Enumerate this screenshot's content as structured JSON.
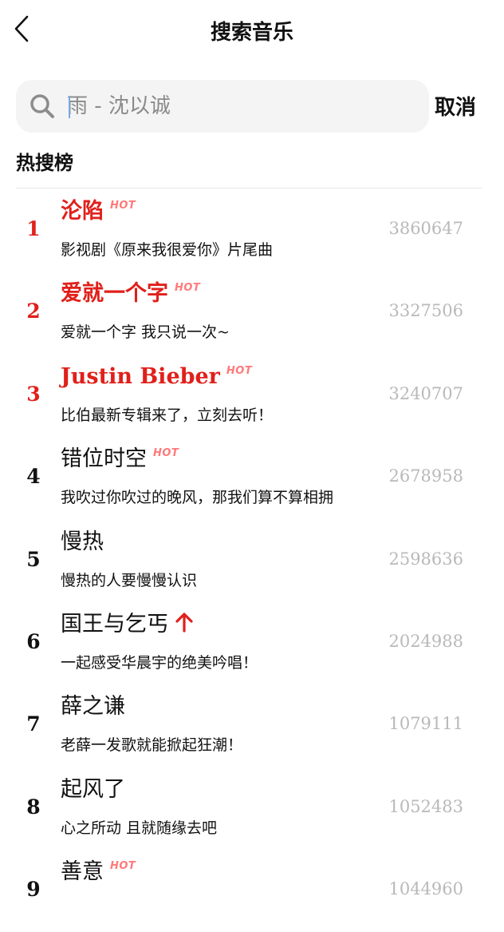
{
  "header": {
    "title": "搜索音乐",
    "back_icon": "chevron-left-icon"
  },
  "search": {
    "placeholder": "雨 - 沈以诚",
    "value": "",
    "cancel_label": "取消",
    "icon": "search-icon"
  },
  "section": {
    "title": "热搜榜"
  },
  "colors": {
    "accent_red": "#e0201b",
    "hot_badge": "#ff7a7a",
    "count_gray": "#b9b9b9",
    "search_bg": "#f4f4f4"
  },
  "hot_list": [
    {
      "rank": "1",
      "name": "沦陷",
      "desc": "影视剧《原来我很爱你》片尾曲",
      "count": "3860647",
      "badge": "HOT"
    },
    {
      "rank": "2",
      "name": "爱就一个字",
      "desc": "爱就一个字 我只说一次~",
      "count": "3327506",
      "badge": "HOT"
    },
    {
      "rank": "3",
      "name": "Justin Bieber",
      "desc": "比伯最新专辑来了，立刻去听！",
      "count": "3240707",
      "badge": "HOT"
    },
    {
      "rank": "4",
      "name": "错位时空",
      "desc": "我吹过你吹过的晚风，那我们算不算相拥",
      "count": "2678958",
      "badge": "HOT"
    },
    {
      "rank": "5",
      "name": "慢热",
      "desc": "慢热的人要慢慢认识",
      "count": "2598636",
      "badge": ""
    },
    {
      "rank": "6",
      "name": "国王与乞丐",
      "desc": "一起感受华晨宇的绝美吟唱！",
      "count": "2024988",
      "badge": "up-arrow-icon"
    },
    {
      "rank": "7",
      "name": "薛之谦",
      "desc": "老薛一发歌就能掀起狂潮！",
      "count": "1079111",
      "badge": ""
    },
    {
      "rank": "8",
      "name": "起风了",
      "desc": "心之所动 且就随缘去吧",
      "count": "1052483",
      "badge": ""
    },
    {
      "rank": "9",
      "name": "善意",
      "desc": "",
      "count": "1044960",
      "badge": "HOT"
    }
  ]
}
